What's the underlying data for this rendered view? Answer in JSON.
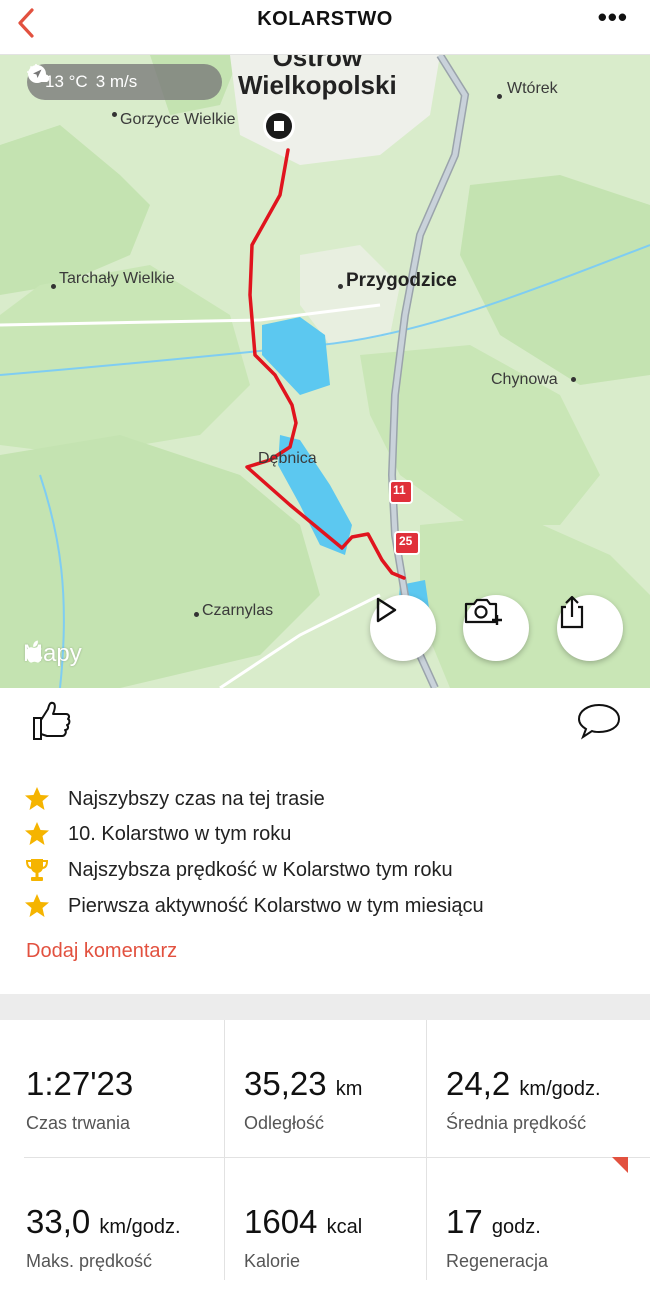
{
  "header": {
    "title": "KOLARSTWO",
    "back_icon": "chevron-left-icon",
    "more_label": "•••"
  },
  "map": {
    "weather": {
      "temperature": "13 °C",
      "wind": "3 m/s"
    },
    "places": {
      "ostrow_line1": "Ostrów",
      "ostrow_line2": "Wielkopolski",
      "gorzyce": "Gorzyce Wielkie",
      "wtorek": "Wtórek",
      "tarchaly": "Tarchały Wielkie",
      "przygodzice": "Przygodzice",
      "chynowa": "Chynowa",
      "debnica": "Dębnica",
      "czarnylas": "Czarnylas"
    },
    "road_labels": {
      "road_11": "11",
      "road_25": "25"
    },
    "brand": "Mapy",
    "route_color": "#e0141e"
  },
  "social": {
    "like_icon": "thumbs-up-icon",
    "comment_icon": "speech-bubble-icon"
  },
  "achievements": [
    {
      "icon": "star-icon",
      "text": "Najszybszy czas na tej trasie"
    },
    {
      "icon": "star-icon",
      "text": "10. Kolarstwo w tym roku"
    },
    {
      "icon": "trophy-icon",
      "text": "Najszybsza prędkość w Kolarstwo tym roku"
    },
    {
      "icon": "star-icon",
      "text": "Pierwsza aktywność Kolarstwo w tym miesiącu"
    }
  ],
  "add_comment_label": "Dodaj komentarz",
  "stats": [
    {
      "value": "1:27'23",
      "unit": "",
      "label": "Czas trwania"
    },
    {
      "value": "35,23",
      "unit": "km",
      "label": "Odległość"
    },
    {
      "value": "24,2",
      "unit": "km/godz.",
      "label": "Średnia prędkość"
    },
    {
      "value": "33,0",
      "unit": "km/godz.",
      "label": "Maks. prędkość"
    },
    {
      "value": "1604",
      "unit": "kcal",
      "label": "Kalorie"
    },
    {
      "value": "17",
      "unit": "godz.",
      "label": "Regeneracja"
    }
  ],
  "colors": {
    "accent": "#e2513f",
    "star": "#f5b400",
    "map_green": "#d9eccb",
    "water": "#5cc8f0"
  }
}
